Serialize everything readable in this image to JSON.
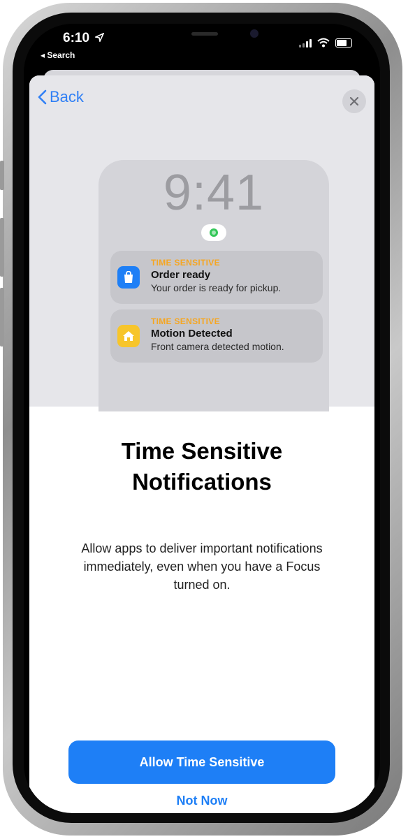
{
  "status_bar": {
    "time": "6:10",
    "back_app": "◂ Search"
  },
  "nav": {
    "back_label": "Back",
    "close_label": "×"
  },
  "preview": {
    "lock_time": "9:41",
    "notifications": [
      {
        "category": "TIME SENSITIVE",
        "title": "Order ready",
        "body": "Your order is ready for pickup.",
        "icon": "shopping-bag-icon",
        "icon_color": "#1e7ff6"
      },
      {
        "category": "TIME SENSITIVE",
        "title": "Motion Detected",
        "body": "Front camera detected motion.",
        "icon": "home-icon",
        "icon_color": "#f7c52b"
      }
    ]
  },
  "main": {
    "title_line1": "Time Sensitive",
    "title_line2": "Notifications",
    "description": "Allow apps to deliver important notifications immediately, even when you have a Focus turned on."
  },
  "actions": {
    "primary": "Allow Time Sensitive",
    "secondary": "Not Now"
  },
  "colors": {
    "accent": "#1e7ff6",
    "time_sensitive": "#f5a623"
  }
}
